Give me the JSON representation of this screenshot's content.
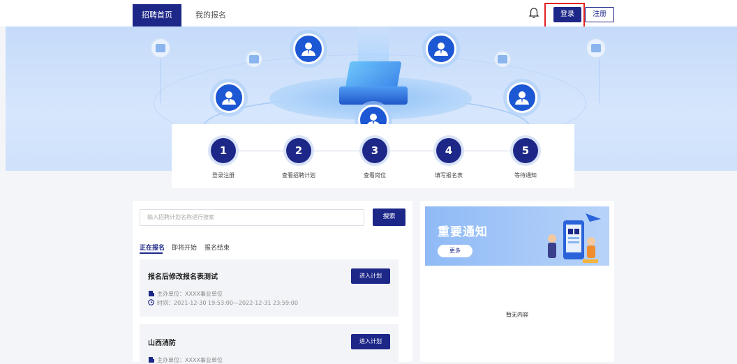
{
  "nav": {
    "home_tab": "招聘首页",
    "my_registration_tab": "我的报名",
    "login_label": "登录",
    "register_label": "注册"
  },
  "steps": [
    {
      "number": "1",
      "label": "登录注册"
    },
    {
      "number": "2",
      "label": "查看招聘计划"
    },
    {
      "number": "3",
      "label": "查看岗位"
    },
    {
      "number": "4",
      "label": "填写报名表"
    },
    {
      "number": "5",
      "label": "等待通知"
    }
  ],
  "search": {
    "placeholder": "输入招聘计划名称进行搜索",
    "button_label": "搜索"
  },
  "filter_tabs": [
    {
      "label": "正在报名",
      "active": true
    },
    {
      "label": "即将开始",
      "active": false
    },
    {
      "label": "报名结束",
      "active": false
    }
  ],
  "plans": [
    {
      "title": "报名后修改报名表测试",
      "button_label": "进入计划",
      "org": "主办单位：XXXX事业单位",
      "time": "时间：2021-12-30 19:53:00—2022-12-31 23:59:00"
    },
    {
      "title": "山西消防",
      "button_label": "进入计划",
      "org": "主办单位：XXXX事业单位"
    }
  ],
  "notice": {
    "title": "重要通知",
    "more_label": "更多",
    "empty_text": "暂无内容"
  },
  "colors": {
    "primary": "#1d2788",
    "highlight_border": "#e32222",
    "banner_bg": "#c5dbfa"
  }
}
